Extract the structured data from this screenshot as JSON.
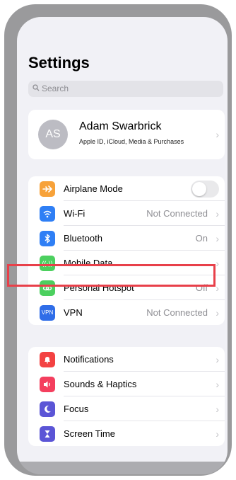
{
  "page": {
    "title": "Settings"
  },
  "search": {
    "placeholder": "Search"
  },
  "account": {
    "initials": "AS",
    "name": "Adam Swarbrick",
    "subtitle": "Apple ID, iCloud, Media & Purchases"
  },
  "colors": {
    "airplane": "#f7a23a",
    "wifi": "#2f7ff5",
    "bluetooth": "#2f7ff5",
    "mobile_data": "#4cd05f",
    "hotspot": "#4cd05f",
    "vpn": "#2f6de8",
    "notifications": "#f34242",
    "sounds": "#f43f5e",
    "focus": "#5b55d6",
    "screen_time": "#5b55d6",
    "highlight": "#e8404a"
  },
  "connectivity": [
    {
      "label": "Airplane Mode",
      "value": "",
      "icon": "airplane-icon",
      "toggle": true
    },
    {
      "label": "Wi-Fi",
      "value": "Not Connected",
      "icon": "wifi-icon"
    },
    {
      "label": "Bluetooth",
      "value": "On",
      "icon": "bluetooth-icon"
    },
    {
      "label": "Mobile Data",
      "value": "",
      "icon": "antenna-icon"
    },
    {
      "label": "Personal Hotspot",
      "value": "Off",
      "icon": "link-icon"
    },
    {
      "label": "VPN",
      "value": "Not Connected",
      "icon": "vpn-icon",
      "icon_text": "VPN"
    }
  ],
  "system": [
    {
      "label": "Notifications",
      "icon": "bell-icon"
    },
    {
      "label": "Sounds & Haptics",
      "icon": "speaker-icon"
    },
    {
      "label": "Focus",
      "icon": "moon-icon"
    },
    {
      "label": "Screen Time",
      "icon": "hourglass-icon"
    }
  ]
}
